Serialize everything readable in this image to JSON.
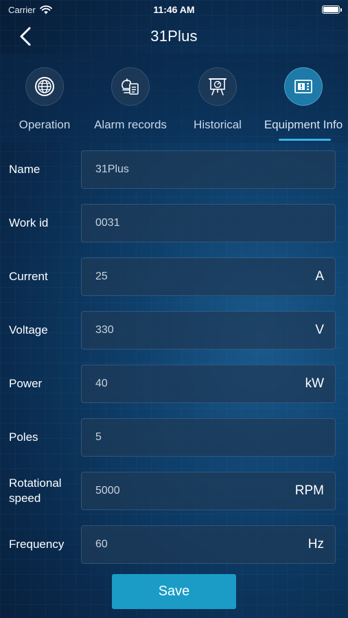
{
  "status_bar": {
    "carrier": "Carrier",
    "time": "11:46 AM"
  },
  "nav": {
    "title": "31Plus"
  },
  "tabs": [
    {
      "label": "Operation",
      "icon": "globe-icon",
      "active": false
    },
    {
      "label": "Alarm records",
      "icon": "alarm-document-icon",
      "active": false
    },
    {
      "label": "Historical",
      "icon": "presentation-board-icon",
      "active": false
    },
    {
      "label": "Equipment Info",
      "icon": "info-panel-icon",
      "active": true
    }
  ],
  "form": {
    "fields": [
      {
        "label": "Name",
        "value": "31Plus",
        "unit": ""
      },
      {
        "label": "Work id",
        "value": "0031",
        "unit": ""
      },
      {
        "label": "Current",
        "value": "25",
        "unit": "A"
      },
      {
        "label": "Voltage",
        "value": "330",
        "unit": "V"
      },
      {
        "label": "Power",
        "value": "40",
        "unit": "kW"
      },
      {
        "label": "Poles",
        "value": "5",
        "unit": ""
      },
      {
        "label": "Rotational speed",
        "value": "5000",
        "unit": "RPM"
      },
      {
        "label": "Frequency",
        "value": "60",
        "unit": "Hz"
      }
    ]
  },
  "save_label": "Save",
  "colors": {
    "accent": "#1a9cc7",
    "tab_underline": "#3bb4e8",
    "active_tab_icon": "#1e7aa8"
  }
}
